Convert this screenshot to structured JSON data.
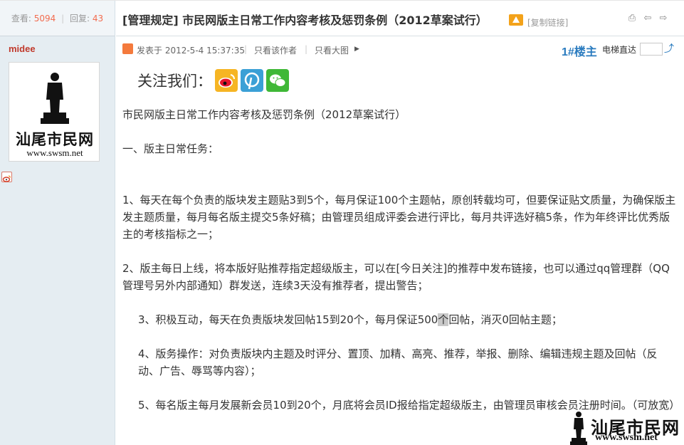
{
  "stats": {
    "views_label": "查看:",
    "views": "5094",
    "sep": "|",
    "replies_label": "回复:",
    "replies": "43"
  },
  "author": {
    "name": "midee",
    "avatar_text": "汕尾市民网",
    "avatar_url": "www.swsm.net"
  },
  "post": {
    "title": "[管理规定] 市民网版主日常工作内容考核及惩罚条例（2012草案试行）",
    "copy_link": "[复制链接]",
    "posted_at": "发表于 2012-5-4 15:37:35",
    "only_author": "只看该作者",
    "only_big_images": "只看大图",
    "floor": "1#楼主",
    "jump_label": "电梯直达",
    "follow_label": "关注我们："
  },
  "content": {
    "p1": "市民网版主日常工作内容考核及惩罚条例（2012草案试行）",
    "p2": "一、版主日常任务：",
    "p3": "1、每天在每个负责的版块发主题贴3到5个，每月保证100个主题帖，原创转载均可，但要保证贴文质量，为确保版主发主题质量，每月每名版主提交5条好稿；由管理员组成评委会进行评比，每月共评选好稿5条，作为年终评比优秀版主的考核指标之一；",
    "p4": "2、版主每日上线，将本版好贴推荐指定超级版主，可以在[今日关注]的推荐中发布链接，也可以通过qq管理群（QQ管理号另外内部通知）群发送，连续3天没有推荐者，提出警告；",
    "p5a": "3、积极互动，每天在负责版块发回帖15到20个，每月保证500",
    "p5b": "个",
    "p5c": "回帖，消灭0回帖主题；",
    "p6": "4、版务操作：对负责版块内主题及时评分、置顶、加精、高亮、推荐，举报、删除、编辑违规主题及回帖（反动、广告、辱骂等内容）；",
    "p7": "5、每名版主每月发展新会员10到20个，月底将会员ID报给指定超级版主，由管理员审核会员注册时间。（可放宽）"
  },
  "watermark": {
    "text": "汕尾市民网",
    "url": "www.swsm.net"
  },
  "colors": {
    "accent": "#2a7bbf",
    "count": "#f26c4f",
    "author": "#c0392b",
    "sidebar_bg": "#e5edf2"
  },
  "icons": [
    "author-avatar-icon",
    "hot-icon",
    "print-icon",
    "prev-icon",
    "next-icon",
    "play-icon",
    "go-arrow-icon",
    "weibo-icon",
    "pinterest-icon",
    "wechat-icon",
    "figure-icon"
  ]
}
